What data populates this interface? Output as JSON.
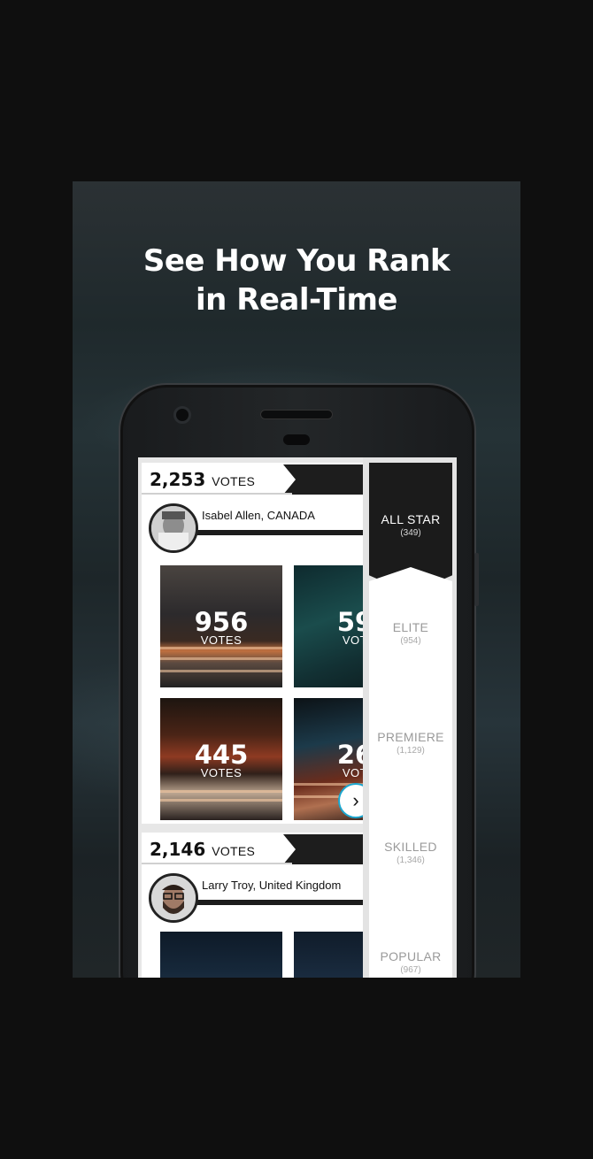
{
  "headline": {
    "line1": "See How You Rank",
    "line2": "in Real-Time"
  },
  "feed": [
    {
      "votes": "2,253",
      "votes_label": "VOTES",
      "user": "Isabel Allen, CANADA",
      "photos": [
        {
          "votes": "956",
          "label": "VOTES"
        },
        {
          "votes": "59",
          "label": "VOT"
        },
        {
          "votes": "445",
          "label": "VOTES"
        },
        {
          "votes": "26",
          "label": "VOT"
        }
      ]
    },
    {
      "votes": "2,146",
      "votes_label": "VOTES",
      "user": "Larry Troy, United Kingdom"
    }
  ],
  "next_button": "›",
  "tiers": [
    {
      "name": "ALL STAR",
      "count": "(349)",
      "active": true
    },
    {
      "name": "ELITE",
      "count": "(954)"
    },
    {
      "name": "PREMIERE",
      "count": "(1,129)"
    },
    {
      "name": "SKILLED",
      "count": "(1,346)"
    },
    {
      "name": "POPULAR",
      "count": "(967)"
    }
  ],
  "colors": {
    "accent": "#1aa7d0",
    "dark": "#1b1b1b"
  }
}
